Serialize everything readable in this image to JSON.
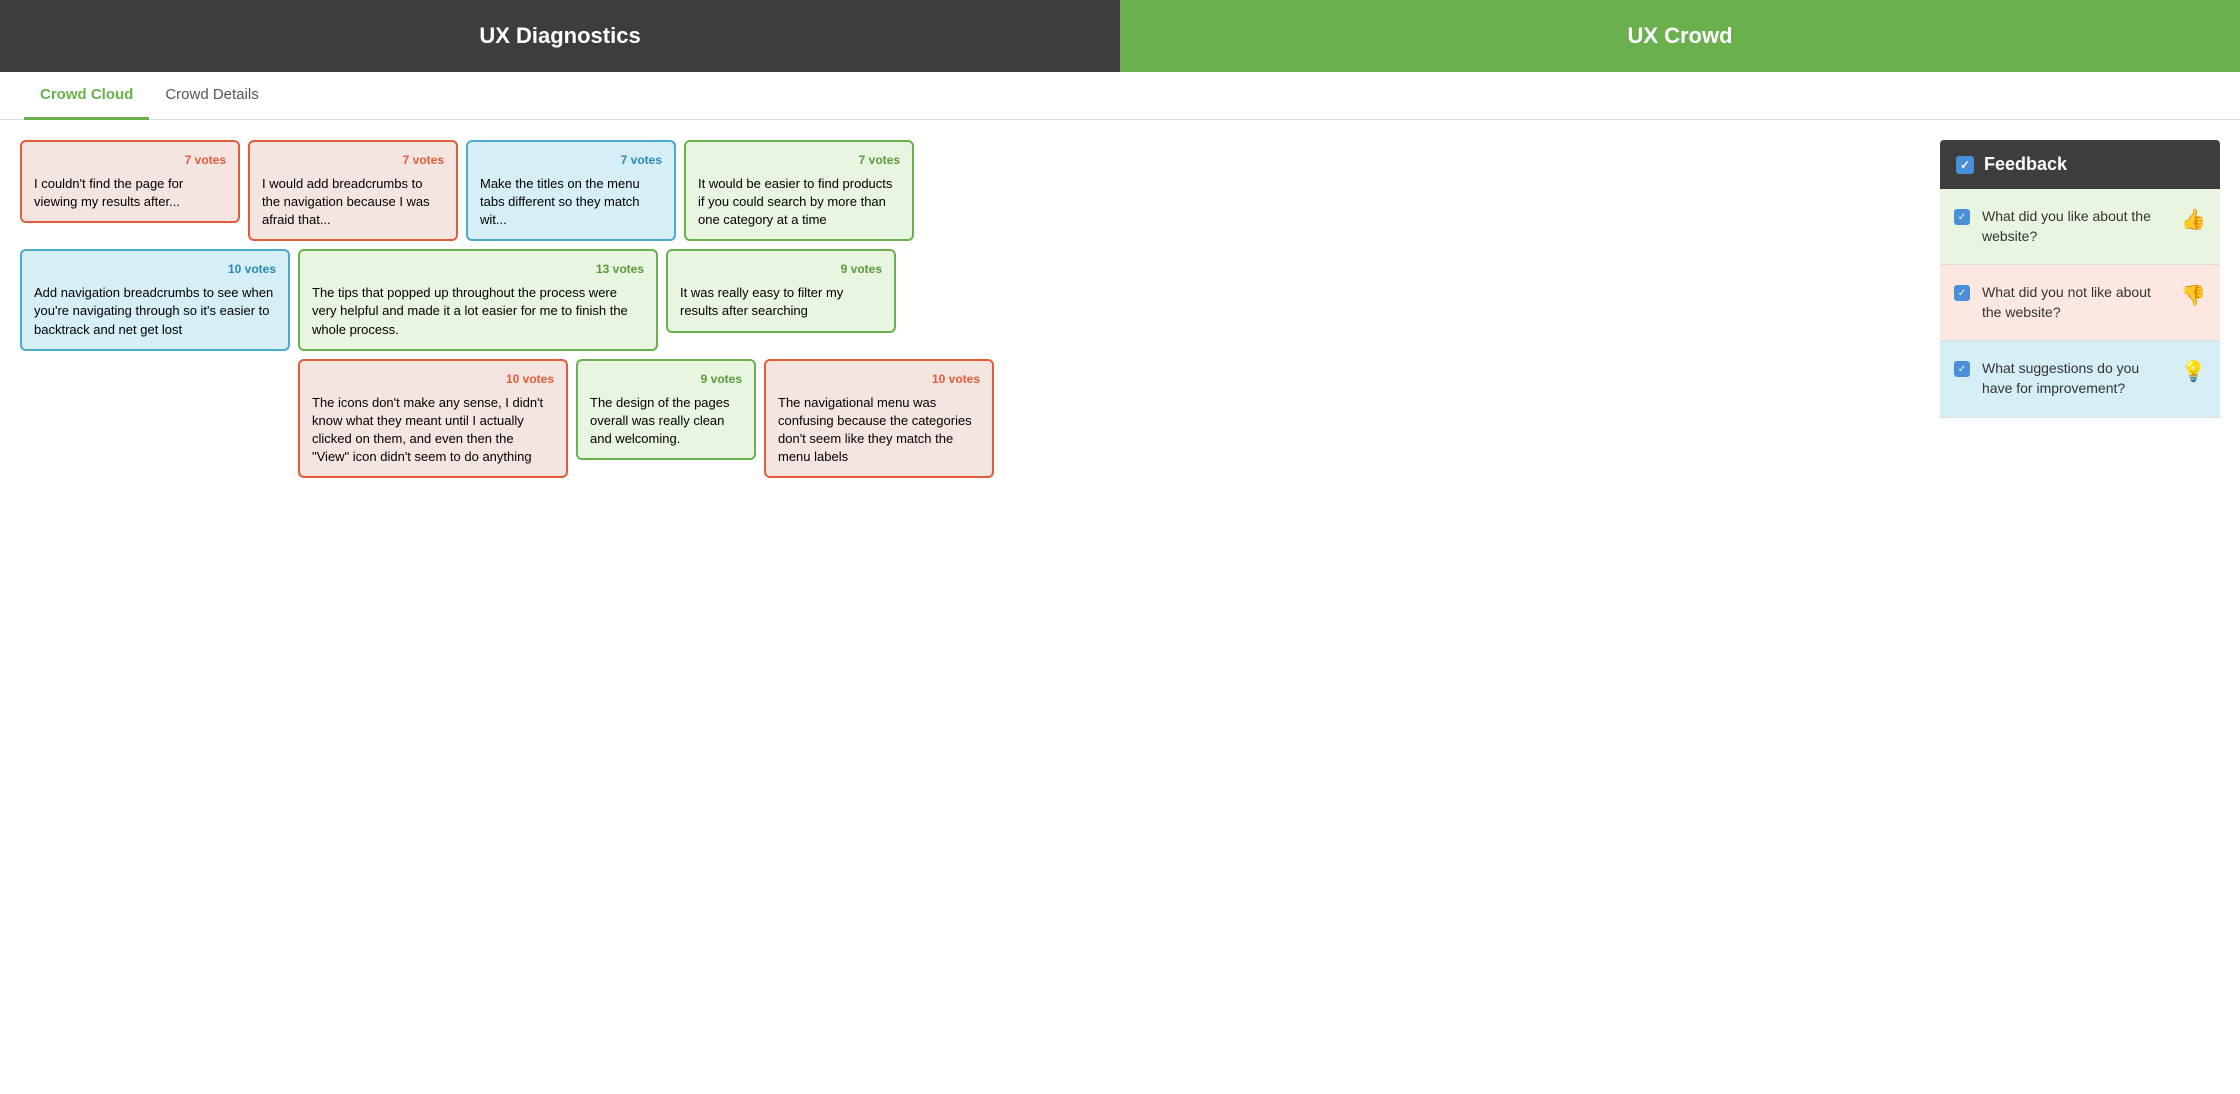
{
  "header": {
    "left_title": "UX Diagnostics",
    "right_title": "UX Crowd"
  },
  "tabs": [
    {
      "label": "Crowd Cloud",
      "active": true
    },
    {
      "label": "Crowd Details",
      "active": false
    }
  ],
  "cards": {
    "row1": [
      {
        "id": "card-r1c1",
        "color": "red",
        "votes": "7 votes",
        "text": "I couldn't find the page for viewing my results after..."
      },
      {
        "id": "card-r1c2",
        "color": "red",
        "votes": "7 votes",
        "text": "I would add breadcrumbs to the navigation because I was afraid that..."
      },
      {
        "id": "card-r1c3",
        "color": "blue",
        "votes": "7 votes",
        "text": "Make the titles on the menu tabs different so they match wit..."
      },
      {
        "id": "card-r1c4",
        "color": "green",
        "votes": "7 votes",
        "text": "It would be easier to find products if you could search by more than one category at a time"
      }
    ],
    "row2": [
      {
        "id": "card-r2c1",
        "color": "blue",
        "votes": "10 votes",
        "text": "Add navigation breadcrumbs to see when you're navigating through so it's easier to backtrack and net get lost",
        "wide": true
      },
      {
        "id": "card-r2c2",
        "color": "green",
        "votes": "13 votes",
        "text": "The tips that popped up throughout the process were very helpful and made it a lot easier for me to finish the whole process.",
        "wide": true
      },
      {
        "id": "card-r2c3",
        "color": "green",
        "votes": "9 votes",
        "text": "It was really easy to filter my results after searching"
      }
    ],
    "row3": [
      {
        "id": "card-r3c1",
        "color": "red",
        "votes": "10 votes",
        "text": "The icons don't make any sense, I didn't know what they meant until I actually clicked on them, and even then the \"View\" icon didn't seem to do anything",
        "wide": true,
        "offset": true
      },
      {
        "id": "card-r3c2",
        "color": "green",
        "votes": "9 votes",
        "text": "The design of the pages overall was really clean and welcoming."
      },
      {
        "id": "card-r3c3",
        "color": "red",
        "votes": "10 votes",
        "text": "The navigational menu was confusing because the categories don't seem like they match the menu labels"
      }
    ]
  },
  "sidebar": {
    "title": "Feedback",
    "items": [
      {
        "id": "feedback-like",
        "bg": "like-bg",
        "text": "What did you like about the website?",
        "icon": "thumb-up",
        "checked": true
      },
      {
        "id": "feedback-dislike",
        "bg": "dislike-bg",
        "text": "What did you not like about the website?",
        "icon": "thumb-down",
        "checked": true
      },
      {
        "id": "feedback-suggest",
        "bg": "suggest-bg",
        "text": "What suggestions do you have for improvement?",
        "icon": "bulb",
        "checked": true
      }
    ]
  }
}
